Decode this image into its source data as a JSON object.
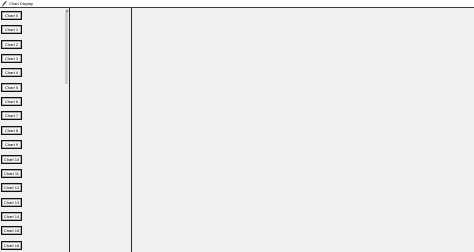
{
  "window": {
    "title": "Chart Display"
  },
  "sidebar": {
    "buttons": [
      {
        "label": "Chart 0"
      },
      {
        "label": "Chart 1"
      },
      {
        "label": "Chart 2"
      },
      {
        "label": "Chart 3"
      },
      {
        "label": "Chart 4"
      },
      {
        "label": "Chart 5"
      },
      {
        "label": "Chart 6"
      },
      {
        "label": "Chart 7"
      },
      {
        "label": "Chart 8"
      },
      {
        "label": "Chart 9"
      },
      {
        "label": "Chart 10"
      },
      {
        "label": "Chart 11"
      },
      {
        "label": "Chart 12"
      },
      {
        "label": "Chart 13"
      },
      {
        "label": "Chart 14"
      },
      {
        "label": "Chart 15"
      },
      {
        "label": "Chart 16"
      }
    ]
  },
  "icons": {
    "app": "feather-icon",
    "scroll_up": "triangle-up-icon"
  },
  "colors": {
    "background": "#f0f0f0",
    "divider": "#2a2a2a",
    "scroll_thumb": "#cdcdcd"
  }
}
